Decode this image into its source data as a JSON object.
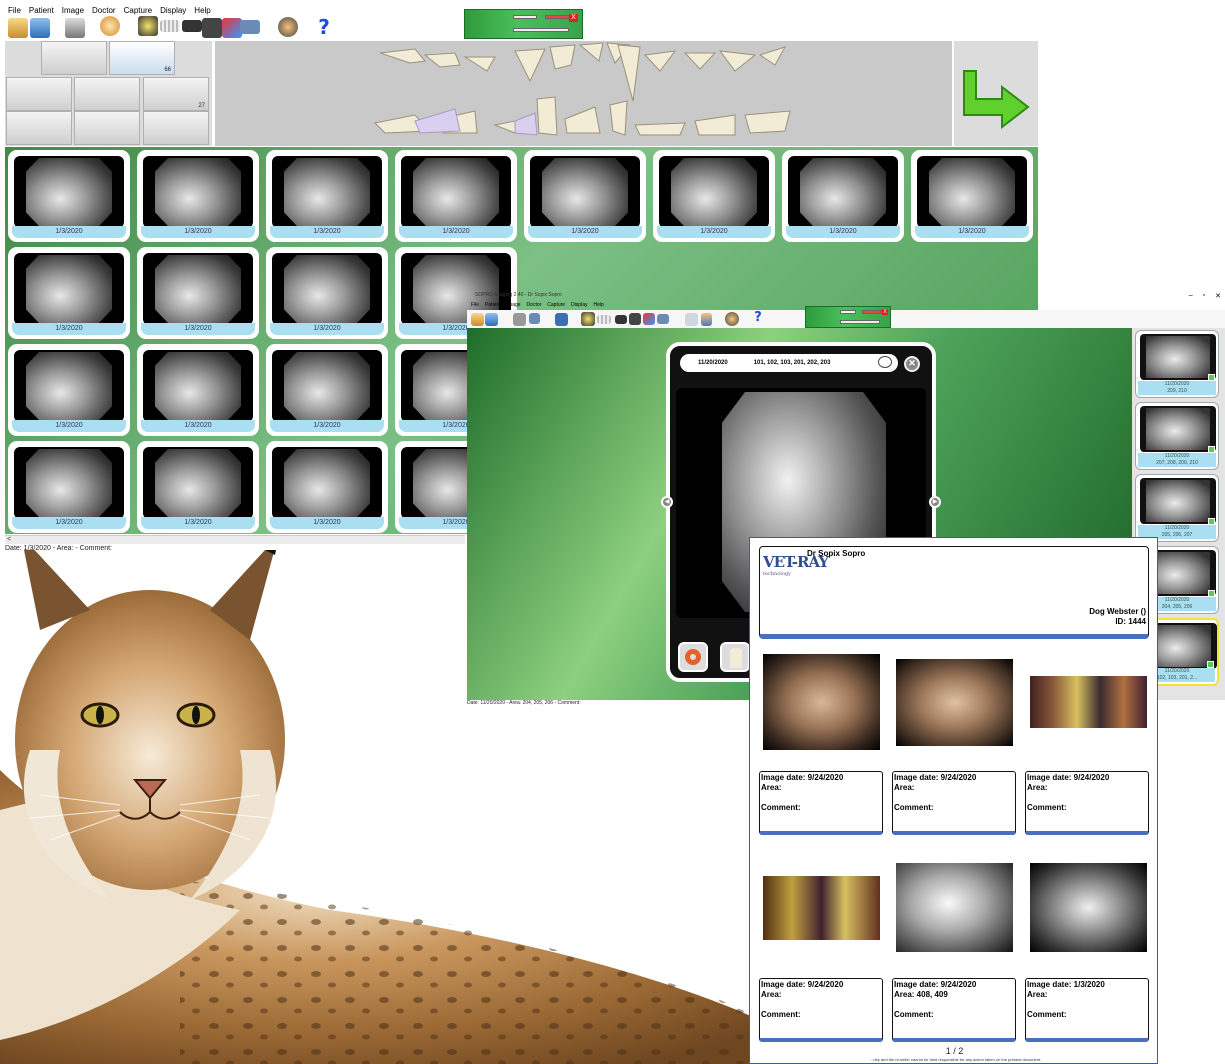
{
  "main": {
    "menu": [
      "File",
      "Patient",
      "Image",
      "Doctor",
      "Capture",
      "Display",
      "Help"
    ],
    "help_icon": "?",
    "tooth_counts": {
      "xray": "66",
      "import": "27"
    },
    "thumbnails": {
      "date": "1/3/2020",
      "rows": 4,
      "cols_full": 8,
      "cols_partial": 4
    },
    "scroll_left": "<",
    "status": "Date: 1/3/2020 - Area:  - Comment:"
  },
  "win2": {
    "title": "SOPRO Imaging 2.40 - Dr Sopix Sopro",
    "menu": [
      "File",
      "Patient",
      "Image",
      "Doctor",
      "Capture",
      "Display",
      "Help"
    ],
    "help_icon": "?",
    "window_controls": [
      "–",
      "▫",
      "✕"
    ],
    "viewer": {
      "date": "11/20/2020",
      "teeth": "101, 102, 103, 201, 202, 203",
      "close": "✕"
    },
    "right_thumbs": [
      {
        "date": "11/20/2020",
        "area": "209, 210"
      },
      {
        "date": "11/20/2020",
        "area": "207, 208, 209, 210"
      },
      {
        "date": "11/20/2020",
        "area": "205, 206, 207"
      },
      {
        "date": "11/20/2020",
        "area": "204, 205, 206"
      },
      {
        "date": "11/20/2020",
        "area": "102, 103, 201, 2..."
      }
    ],
    "status": "Date: 11/20/2020 - Area: 204, 205, 206 - Comment:"
  },
  "report": {
    "logo": "VET-RAY",
    "logo_sub": "technology",
    "doctor": "Dr Sopix Sopro",
    "patient": "Dog Webster ()",
    "patient_id": "ID: 1444",
    "items": [
      {
        "date": "Image date: 9/24/2020",
        "area": "Area:",
        "comment": "Comment:"
      },
      {
        "date": "Image date: 9/24/2020",
        "area": "Area:",
        "comment": "Comment:"
      },
      {
        "date": "Image date: 9/24/2020",
        "area": "Area:",
        "comment": "Comment:"
      },
      {
        "date": "Image date: 9/24/2020",
        "area": "Area:",
        "comment": "Comment:"
      },
      {
        "date": "Image date: 9/24/2020",
        "area": "Area: 408, 409",
        "comment": "Comment:"
      },
      {
        "date": "Image date: 1/3/2020",
        "area": "Area:",
        "comment": "Comment:"
      }
    ],
    "page": "1 / 2",
    "disclaimer": "...ney and the re-seller cannot be held responsible for any action taken on the present document."
  },
  "colors": {
    "accent_green": "#49c05a",
    "caption_blue": "#a9dff0",
    "report_blue": "#4a6fbf"
  }
}
